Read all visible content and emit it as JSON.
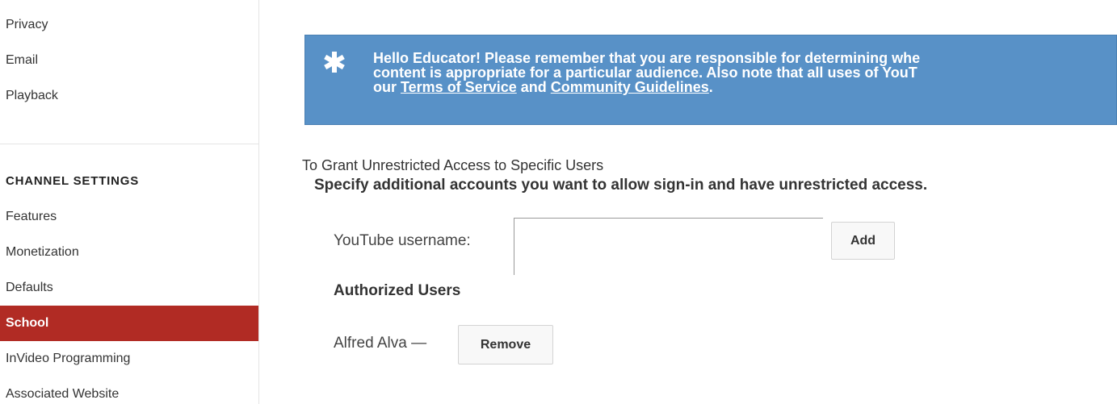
{
  "sidebar": {
    "top_items": [
      {
        "label": "Privacy"
      },
      {
        "label": "Email"
      },
      {
        "label": "Playback"
      }
    ],
    "section_heading": "CHANNEL SETTINGS",
    "channel_items": [
      {
        "label": "Features"
      },
      {
        "label": "Monetization"
      },
      {
        "label": "Defaults"
      },
      {
        "label": "School",
        "active": true
      },
      {
        "label": "InVideo Programming"
      },
      {
        "label": "Associated Website"
      }
    ],
    "active_color": "#b12b24"
  },
  "banner": {
    "icon": "asterisk-icon",
    "line1": "Hello Educator! Please remember that you are responsible for determining whe",
    "line2": "content is appropriate for a particular audience. Also note that all uses of YouT",
    "line3_prefix": "our ",
    "terms_link": "Terms of Service",
    "line3_and": " and ",
    "guidelines_link": "Community Guidelines",
    "line3_suffix": ".",
    "background_color": "#5891c7"
  },
  "grant": {
    "title": "To Grant Unrestricted Access to Specific Users",
    "description": "Specify additional accounts you want to allow sign-in and have unrestricted access.",
    "username_label": "YouTube username:",
    "username_value": "",
    "add_button": "Add"
  },
  "authorized": {
    "heading": "Authorized Users",
    "users": [
      {
        "name": "Alfred Alva —",
        "remove_label": "Remove"
      }
    ]
  }
}
